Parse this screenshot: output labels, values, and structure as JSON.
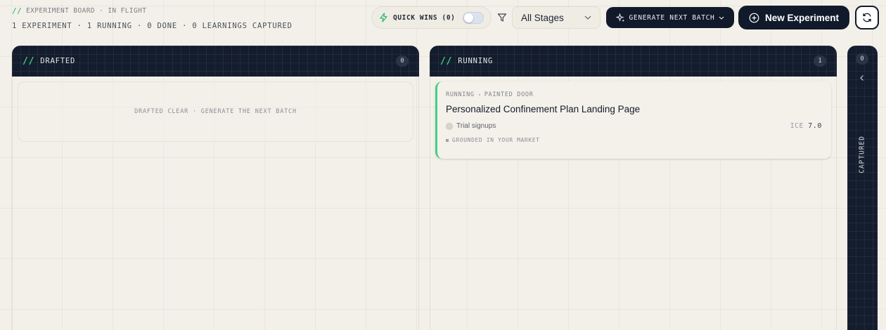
{
  "header": {
    "breadcrumb": "EXPERIMENT BOARD · IN FLIGHT",
    "breadcrumb_prefix": "//",
    "stats": "1 EXPERIMENT · 1 RUNNING · 0 DONE · 0 LEARNINGS CAPTURED"
  },
  "toolbar": {
    "quick_wins_label": "QUICK WINS (0)",
    "quick_wins_on": false,
    "stage_filter_value": "All Stages",
    "generate_label": "GENERATE NEXT BATCH",
    "new_experiment_label": "New Experiment"
  },
  "columns": {
    "drafted": {
      "prefix": "//",
      "title": "DRAFTED",
      "count": "0",
      "empty_text": "DRAFTED CLEAR · GENERATE THE NEXT BATCH"
    },
    "running": {
      "prefix": "//",
      "title": "RUNNING",
      "count": "1",
      "cards": [
        {
          "status": "RUNNING",
          "type": "PAINTED DOOR",
          "title": "Personalized Confinement Plan Landing Page",
          "metric": "Trial signups",
          "ice_label": "ICE",
          "ice_value": "7.0",
          "tag": "GROUNDED IN YOUR MARKET"
        }
      ]
    },
    "captured": {
      "title": "CAPTURED",
      "count": "0"
    }
  },
  "colors": {
    "accent_green": "#45cf84",
    "dark_navy": "#111a2b",
    "background": "#f3f0e9"
  },
  "icons": {
    "quick_wins": "lightning-icon",
    "filter": "filter-icon",
    "stage_dropdown": "chevron-down-icon",
    "generate": "sparkle-icon",
    "new_experiment": "plus-circle-icon",
    "refresh": "refresh-icon",
    "captured_collapse": "chevron-left-icon"
  }
}
